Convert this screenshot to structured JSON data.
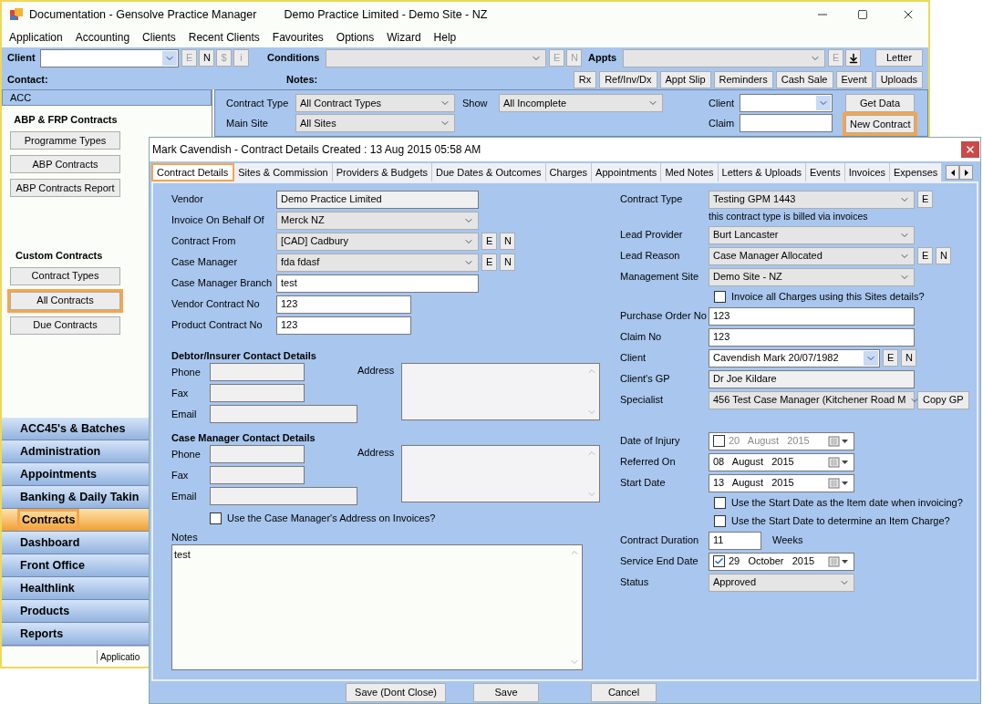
{
  "window": {
    "title": "Documentation - Gensolve Practice Manager",
    "subtitle": "Demo Practice Limited - Demo Site - NZ"
  },
  "menu": [
    "Application",
    "Accounting",
    "Clients",
    "Recent Clients",
    "Favourites",
    "Options",
    "Wizard",
    "Help"
  ],
  "toolbar": {
    "client_label": "Client",
    "client_buttons": [
      {
        "label": "E",
        "disabled": true
      },
      {
        "label": "N",
        "disabled": false
      },
      {
        "label": "$",
        "disabled": true
      },
      {
        "label": "i",
        "disabled": true
      }
    ],
    "conditions_label": "Conditions",
    "conditions_buttons": [
      {
        "label": "E",
        "disabled": true
      },
      {
        "label": "N",
        "disabled": true
      }
    ],
    "appts_label": "Appts",
    "appts_buttons": [
      {
        "label": "E",
        "disabled": true
      }
    ],
    "letter": "Letter",
    "contact_label": "Contact:",
    "notes_label": "Notes:",
    "actions": [
      "Rx",
      "Ref/Inv/Dx",
      "Appt Slip",
      "Reminders",
      "Cash Sale",
      "Event",
      "Uploads"
    ]
  },
  "left_panel": {
    "header": "ACC",
    "section1_title": "ABP & FRP Contracts",
    "section1_buttons": [
      {
        "label": "Programme Types",
        "selected": false
      },
      {
        "label": "ABP Contracts",
        "selected": false
      },
      {
        "label": "ABP Contracts Report",
        "selected": false
      }
    ],
    "section2_title": "Custom Contracts",
    "section2_buttons": [
      {
        "label": "Contract Types",
        "selected": false
      },
      {
        "label": "All Contracts",
        "selected": true
      },
      {
        "label": "Due Contracts",
        "selected": false
      }
    ],
    "nav": [
      {
        "label": "ACC45's & Batches",
        "selected": false
      },
      {
        "label": "Administration",
        "selected": false
      },
      {
        "label": "Appointments",
        "selected": false
      },
      {
        "label": "Banking & Daily Takin",
        "selected": false
      },
      {
        "label": "Contracts",
        "selected": true
      },
      {
        "label": "Dashboard",
        "selected": false
      },
      {
        "label": "Front Office",
        "selected": false
      },
      {
        "label": "Healthlink",
        "selected": false
      },
      {
        "label": "Products",
        "selected": false
      },
      {
        "label": "Reports",
        "selected": false
      }
    ],
    "status": "Applicatio"
  },
  "filters": {
    "contract_type_label": "Contract Type",
    "contract_type": "All Contract Types",
    "show_label": "Show",
    "show": "All Incomplete",
    "main_site_label": "Main Site",
    "main_site": "All Sites",
    "client_label": "Client",
    "claim_label": "Claim",
    "get_data": "Get Data",
    "new_contract": {
      "label": "New Contract",
      "highlighted": true
    }
  },
  "dialog": {
    "title": "Mark Cavendish - Contract Details Created : 13 Aug 2015 05:58 AM",
    "tabs": [
      {
        "label": "Contract Details",
        "selected": true
      },
      {
        "label": "Sites & Commission",
        "selected": false
      },
      {
        "label": "Providers & Budgets",
        "selected": false
      },
      {
        "label": "Due Dates & Outcomes",
        "selected": false
      },
      {
        "label": "Charges",
        "selected": false
      },
      {
        "label": "Appointments",
        "selected": false
      },
      {
        "label": "Med Notes",
        "selected": false
      },
      {
        "label": "Letters & Uploads",
        "selected": false
      },
      {
        "label": "Events",
        "selected": false
      },
      {
        "label": "Invoices",
        "selected": false
      },
      {
        "label": "Expenses",
        "selected": false
      }
    ],
    "left_fields": [
      {
        "kind": "readonly",
        "label": "Vendor",
        "value": "Demo Practice Limited"
      },
      {
        "kind": "select",
        "label": "Invoice On Behalf Of",
        "value": "Merck NZ"
      },
      {
        "kind": "select",
        "label": "Contract From",
        "value": "[CAD] Cadbury",
        "buttons": [
          "E",
          "N"
        ]
      },
      {
        "kind": "select",
        "label": "Case Manager",
        "value": "fda fdasf",
        "buttons": [
          "E",
          "N"
        ]
      },
      {
        "kind": "text",
        "label": "Case Manager Branch",
        "value": "test"
      },
      {
        "kind": "short_text",
        "label": "Vendor Contract No",
        "value": "123"
      },
      {
        "kind": "short_text",
        "label": "Product Contract No",
        "value": "123"
      }
    ],
    "contact_groups": [
      {
        "title": "Debtor/Insurer Contact Details",
        "phone_label": "Phone",
        "fax_label": "Fax",
        "email_label": "Email",
        "address_label": "Address"
      },
      {
        "title": "Case Manager Contact Details",
        "phone_label": "Phone",
        "fax_label": "Fax",
        "email_label": "Email",
        "address_label": "Address"
      }
    ],
    "use_cm_address": {
      "label": "Use the Case Manager's Address on Invoices?",
      "checked": false
    },
    "notes": {
      "label": "Notes",
      "value": "test"
    },
    "right_fields": [
      {
        "kind": "select",
        "label": "Contract Type",
        "value": "Testing GPM 1443",
        "buttons": [
          "E"
        ]
      },
      {
        "kind": "hint",
        "text": "this contract type is billed via invoices"
      },
      {
        "kind": "select",
        "label": "Lead Provider",
        "value": "Burt Lancaster"
      },
      {
        "kind": "select",
        "label": "Lead Reason",
        "value": "Case Manager Allocated",
        "buttons": [
          "E",
          "N"
        ]
      },
      {
        "kind": "select",
        "label": "Management Site",
        "value": "Demo Site - NZ"
      },
      {
        "kind": "checkbox",
        "label": "Invoice all Charges using this Sites details?",
        "checked": false
      },
      {
        "kind": "text",
        "label": "Purchase Order No",
        "value": "123"
      },
      {
        "kind": "text",
        "label": "Claim No",
        "value": "123"
      },
      {
        "kind": "combo",
        "label": "Client",
        "value": "Cavendish Mark 20/07/1982",
        "buttons": [
          "E",
          "N"
        ]
      },
      {
        "kind": "readonly",
        "label": "Client's GP",
        "value": "Dr Joe Kildare"
      },
      {
        "kind": "select",
        "label": "Specialist",
        "value": "456 Test Case Manager (Kitchener Road M",
        "buttons": [
          "Copy GP"
        ]
      }
    ],
    "date_fields": [
      {
        "kind": "date",
        "label": "Date of Injury",
        "value": "20   August   2015",
        "has_check": true,
        "checked": false
      },
      {
        "kind": "date",
        "label": "Referred On",
        "value": "08   August   2015",
        "has_check": false
      },
      {
        "kind": "date",
        "label": "Start Date",
        "value": "13   August   2015",
        "has_check": false
      },
      {
        "kind": "checkbox",
        "label": "Use the Start Date as the Item date when invoicing?",
        "checked": false
      },
      {
        "kind": "checkbox",
        "label": "Use the Start Date to determine an Item Charge?",
        "checked": false
      },
      {
        "kind": "duration",
        "label": "Contract Duration",
        "value": "11",
        "unit": "Weeks"
      },
      {
        "kind": "date",
        "label": "Service End Date",
        "value": "29   October   2015",
        "has_check": true,
        "checked": true
      },
      {
        "kind": "short_select",
        "label": "Status",
        "value": "Approved"
      }
    ],
    "footer_buttons": [
      "Save (Dont Close)",
      "Save",
      "Cancel"
    ]
  }
}
